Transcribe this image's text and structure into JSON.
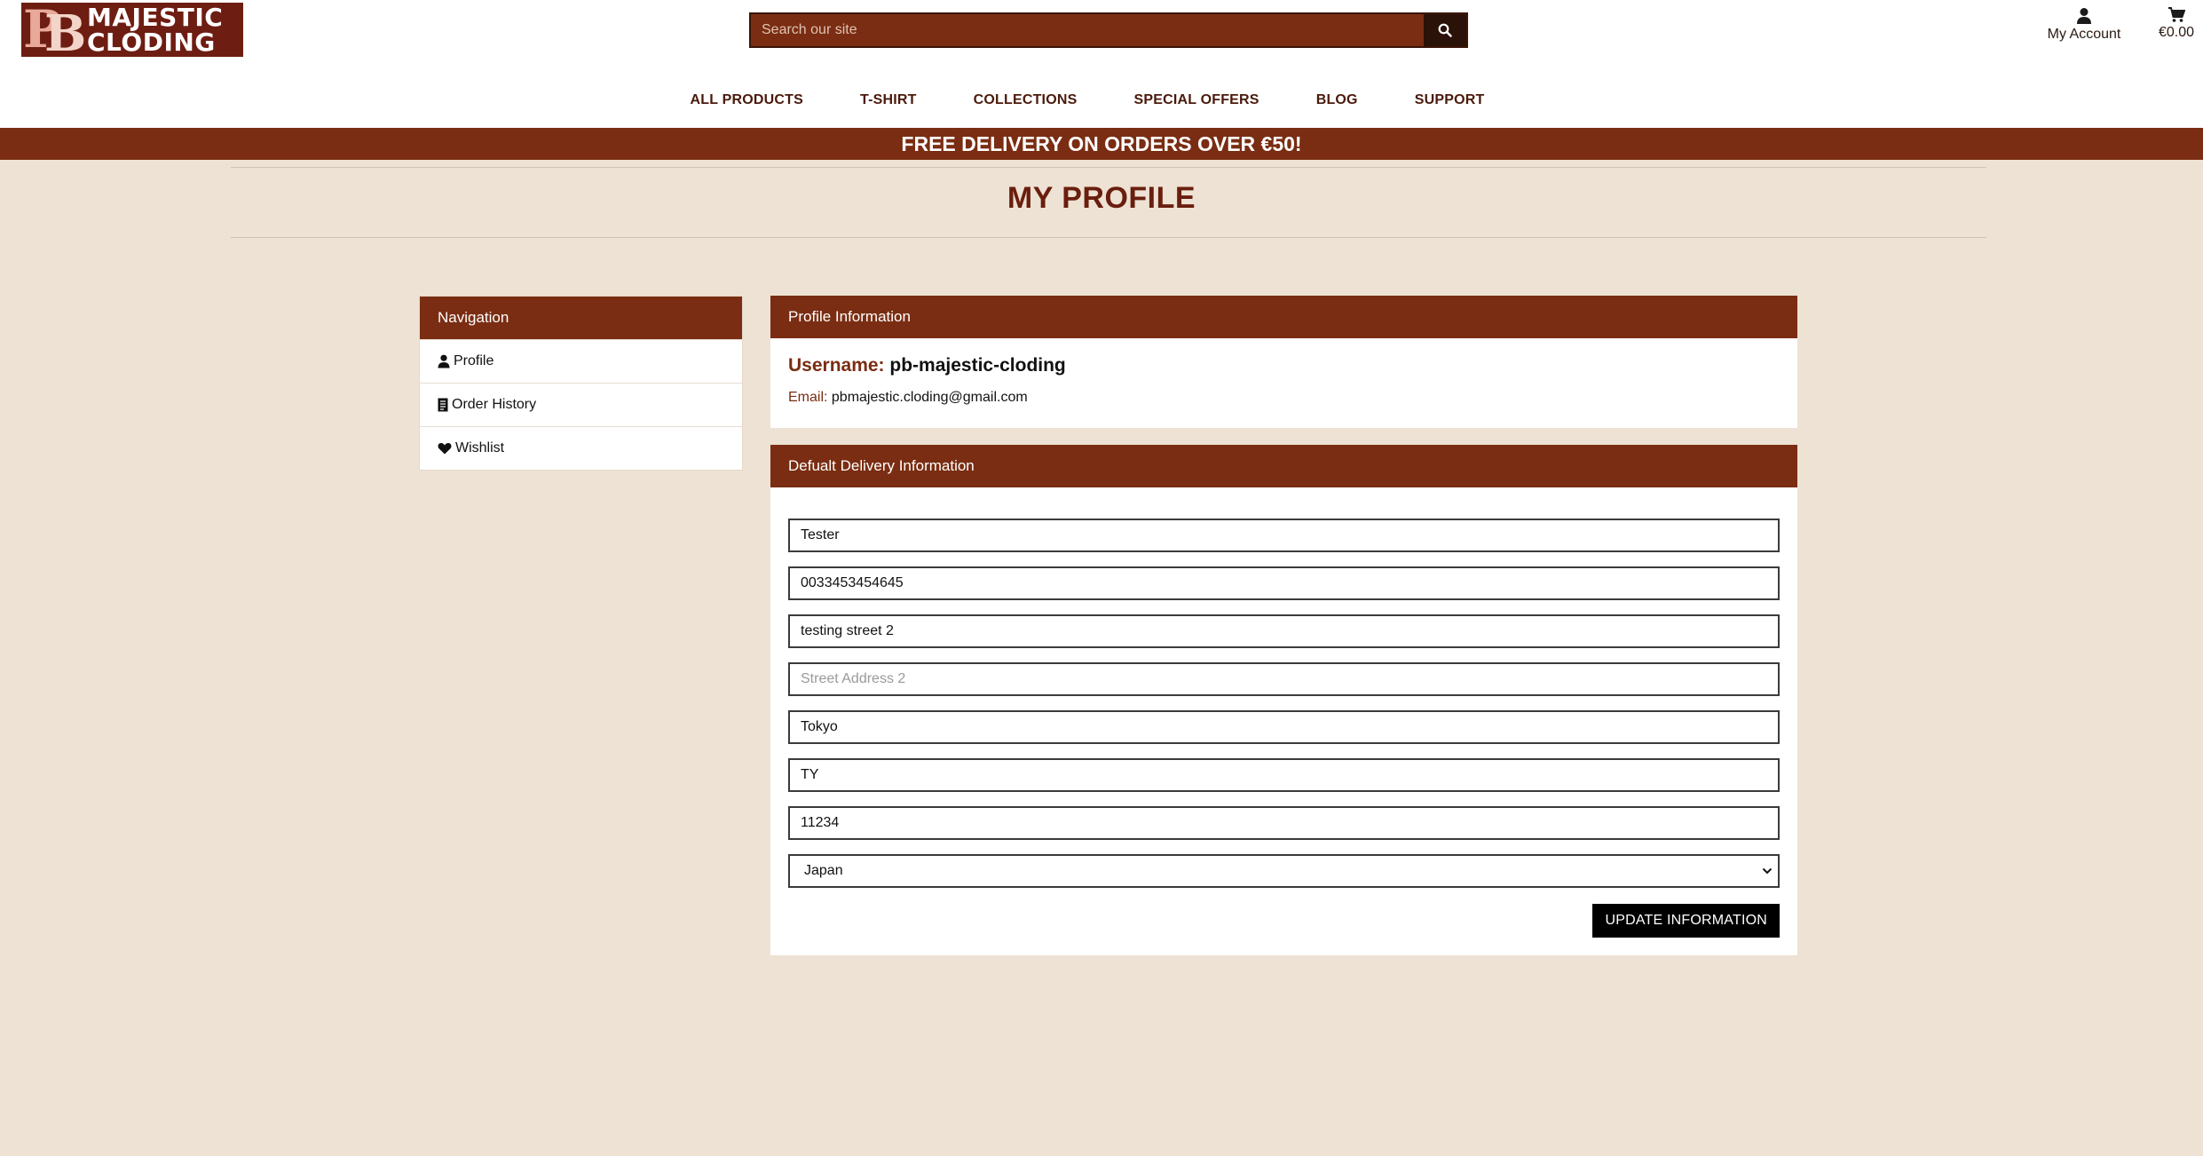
{
  "brand": {
    "logo_line1": "MAJESTIC",
    "logo_line2": "CLODING",
    "logo_mark_a": "P",
    "logo_mark_b": "B"
  },
  "search": {
    "placeholder": "Search our site",
    "icon": "search-icon"
  },
  "header": {
    "account_label": "My Account",
    "cart_total": "€0.00"
  },
  "nav": {
    "items": [
      "ALL PRODUCTS",
      "T-SHIRT",
      "COLLECTIONS",
      "SPECIAL OFFERS",
      "BLOG",
      "SUPPORT"
    ]
  },
  "banner": {
    "text": "FREE DELIVERY ON ORDERS OVER €50!"
  },
  "page": {
    "title": "MY PROFILE"
  },
  "sidebar": {
    "title": "Navigation",
    "items": [
      {
        "label": "Profile",
        "icon": "user-icon"
      },
      {
        "label": "Order History",
        "icon": "receipt-icon"
      },
      {
        "label": "Wishlist",
        "icon": "heart-icon"
      }
    ]
  },
  "profile": {
    "title": "Profile Information",
    "username_label": "Username:",
    "username": "pb-majestic-cloding",
    "email_label": "Email:",
    "email": "pbmajestic.cloding@gmail.com"
  },
  "delivery": {
    "title": "Defualt Delivery Information",
    "full_name": "Tester",
    "phone": "0033453454645",
    "street1": "testing street 2",
    "street2": "",
    "street2_placeholder": "Street Address 2",
    "city": "Tokyo",
    "county": "TY",
    "postcode": "11234",
    "country": "Japan",
    "button_label": "UPDATE INFORMATION"
  },
  "colors": {
    "brand": "#7a2d12",
    "background": "#ede2d3",
    "title": "#6a1e0e"
  }
}
